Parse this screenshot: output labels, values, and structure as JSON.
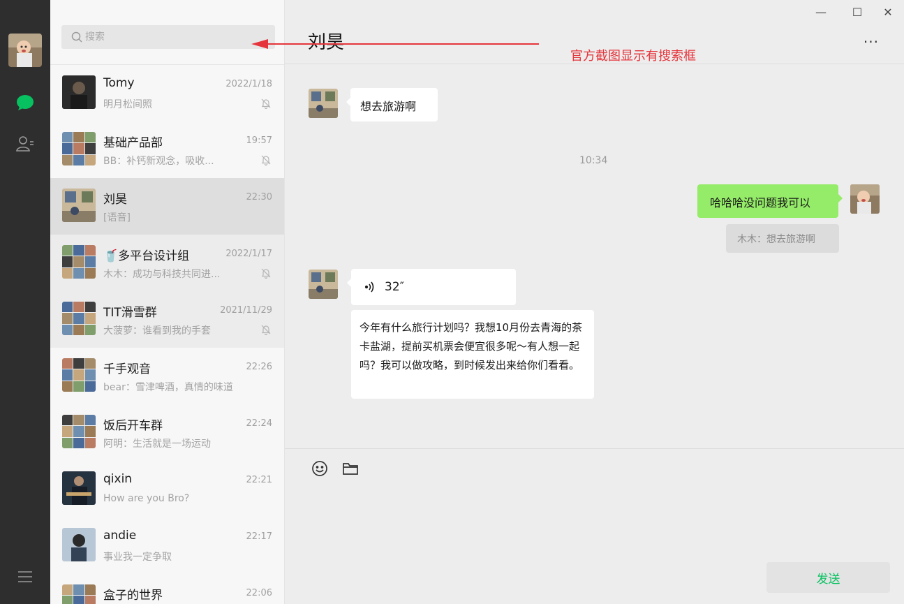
{
  "search": {
    "placeholder": "搜索"
  },
  "chat": {
    "title": "刘昊",
    "more_label": "···",
    "messages": {
      "m1": "想去旅游啊",
      "timestamp": "10:34",
      "m2": "哈哈哈没问题我可以",
      "m2_quote": "木木：想去旅游啊",
      "voice_duration": "32″",
      "m3": "今年有什么旅行计划吗？我想10月份去青海的茶卡盐湖，提前买机票会便宜很多呢～有人想一起吗？我可以做攻略，到时候发出来给你们看看。"
    },
    "send_label": "发送"
  },
  "window_controls": {
    "minimize": "—",
    "maximize": "☐",
    "close": "✕"
  },
  "annotation": {
    "text": "官方截图显示有搜索框",
    "color": "#e5343b"
  },
  "conversations": [
    {
      "name": "Tomy",
      "time": "2022/1/18",
      "preview": "明月松间照",
      "muted": true,
      "avatar": "photo-dark"
    },
    {
      "name": "基础产品部",
      "time": "19:57",
      "preview": "BB：补钙新观念，吸收...",
      "muted": true,
      "avatar": "group"
    },
    {
      "name": "刘昊",
      "time": "22:30",
      "preview": "[语音]",
      "muted": false,
      "avatar": "photo-room",
      "active": true
    },
    {
      "name": "🥤多平台设计组",
      "time": "2022/1/17",
      "preview": "木木：成功与科技共同进...",
      "muted": true,
      "avatar": "group"
    },
    {
      "name": "TIT滑雪群",
      "time": "2021/11/29",
      "preview": "大菠萝：谁看到我的手套",
      "muted": true,
      "avatar": "group"
    },
    {
      "name": "千手观音",
      "time": "22:26",
      "preview": "bear：雪津啤酒，真情的味道",
      "muted": false,
      "avatar": "group"
    },
    {
      "name": "饭后开车群",
      "time": "22:24",
      "preview": "阿明：生活就是一场运动",
      "muted": false,
      "avatar": "group"
    },
    {
      "name": "qixin",
      "time": "22:21",
      "preview": "How are you Bro?",
      "muted": false,
      "avatar": "photo-guitar"
    },
    {
      "name": "andie",
      "time": "22:17",
      "preview": "事业我一定争取",
      "muted": false,
      "avatar": "photo-girl"
    },
    {
      "name": "盒子的世界",
      "time": "22:06",
      "preview": "",
      "muted": false,
      "avatar": "group"
    }
  ],
  "colors": {
    "accent": "#07c160",
    "self_bubble": "#95ec69",
    "rail": "#2e2e2e"
  }
}
